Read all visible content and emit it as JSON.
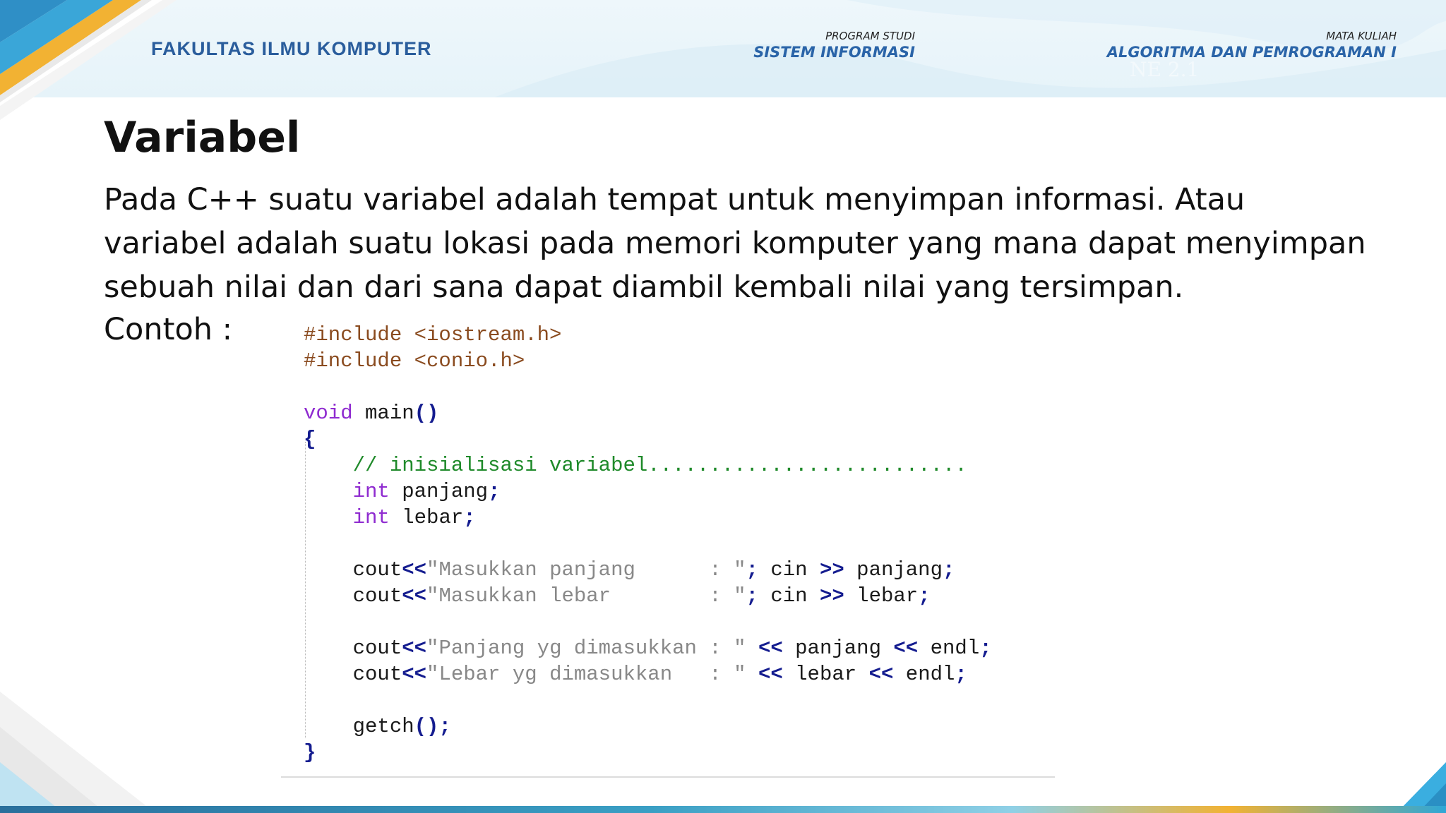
{
  "header": {
    "faculty": "FAKULTAS ILMU KOMPUTER",
    "program_label": "PROGRAM STUDI",
    "program_value": "SISTEM INFORMASI",
    "course_label": "MATA KULIAH",
    "course_value": "ALGORITMA DAN PEMROGRAMAN I",
    "ghost_text": "NE 2.1"
  },
  "slide": {
    "title": "Variabel",
    "paragraph": "Pada C++ suatu variabel adalah tempat untuk menyimpan informasi. Atau  variabel adalah suatu lokasi pada memori komputer yang mana dapat menyimpan sebuah nilai dan dari sana dapat diambil kembali nilai yang tersimpan.",
    "example_label": "Contoh :"
  },
  "code": {
    "lines": [
      [
        {
          "t": "#include <iostream.h>",
          "k": "pre"
        }
      ],
      [
        {
          "t": "#include <conio.h>",
          "k": "pre"
        }
      ],
      [],
      [
        {
          "t": "void",
          "k": "kw"
        },
        {
          "t": " main",
          "k": "plain"
        },
        {
          "t": "()",
          "k": "op"
        }
      ],
      [
        {
          "t": "{",
          "k": "op"
        }
      ],
      [
        {
          "t": "    // inisialisasi variabel..........................",
          "k": "cm"
        }
      ],
      [
        {
          "t": "    ",
          "k": "plain"
        },
        {
          "t": "int",
          "k": "kw"
        },
        {
          "t": " panjang",
          "k": "plain"
        },
        {
          "t": ";",
          "k": "op"
        }
      ],
      [
        {
          "t": "    ",
          "k": "plain"
        },
        {
          "t": "int",
          "k": "kw"
        },
        {
          "t": " lebar",
          "k": "plain"
        },
        {
          "t": ";",
          "k": "op"
        }
      ],
      [],
      [
        {
          "t": "    cout",
          "k": "plain"
        },
        {
          "t": "<<",
          "k": "op"
        },
        {
          "t": "\"Masukkan panjang      : \"",
          "k": "str"
        },
        {
          "t": ";",
          "k": "op"
        },
        {
          "t": " cin ",
          "k": "plain"
        },
        {
          "t": ">>",
          "k": "op"
        },
        {
          "t": " panjang",
          "k": "plain"
        },
        {
          "t": ";",
          "k": "op"
        }
      ],
      [
        {
          "t": "    cout",
          "k": "plain"
        },
        {
          "t": "<<",
          "k": "op"
        },
        {
          "t": "\"Masukkan lebar        : \"",
          "k": "str"
        },
        {
          "t": ";",
          "k": "op"
        },
        {
          "t": " cin ",
          "k": "plain"
        },
        {
          "t": ">>",
          "k": "op"
        },
        {
          "t": " lebar",
          "k": "plain"
        },
        {
          "t": ";",
          "k": "op"
        }
      ],
      [],
      [
        {
          "t": "    cout",
          "k": "plain"
        },
        {
          "t": "<<",
          "k": "op"
        },
        {
          "t": "\"Panjang yg dimasukkan : \"",
          "k": "str"
        },
        {
          "t": " ",
          "k": "plain"
        },
        {
          "t": "<<",
          "k": "op"
        },
        {
          "t": " panjang ",
          "k": "plain"
        },
        {
          "t": "<<",
          "k": "op"
        },
        {
          "t": " endl",
          "k": "plain"
        },
        {
          "t": ";",
          "k": "op"
        }
      ],
      [
        {
          "t": "    cout",
          "k": "plain"
        },
        {
          "t": "<<",
          "k": "op"
        },
        {
          "t": "\"Lebar yg dimasukkan   : \"",
          "k": "str"
        },
        {
          "t": " ",
          "k": "plain"
        },
        {
          "t": "<<",
          "k": "op"
        },
        {
          "t": " lebar ",
          "k": "plain"
        },
        {
          "t": "<<",
          "k": "op"
        },
        {
          "t": " endl",
          "k": "plain"
        },
        {
          "t": ";",
          "k": "op"
        }
      ],
      [],
      [
        {
          "t": "    getch",
          "k": "plain"
        },
        {
          "t": "();",
          "k": "op"
        }
      ],
      [
        {
          "t": "}",
          "k": "op"
        }
      ]
    ]
  },
  "colors": {
    "accent_blue": "#2a64a8",
    "accent_yellow": "#f2b233",
    "accent_cyan": "#3aa6d8"
  }
}
